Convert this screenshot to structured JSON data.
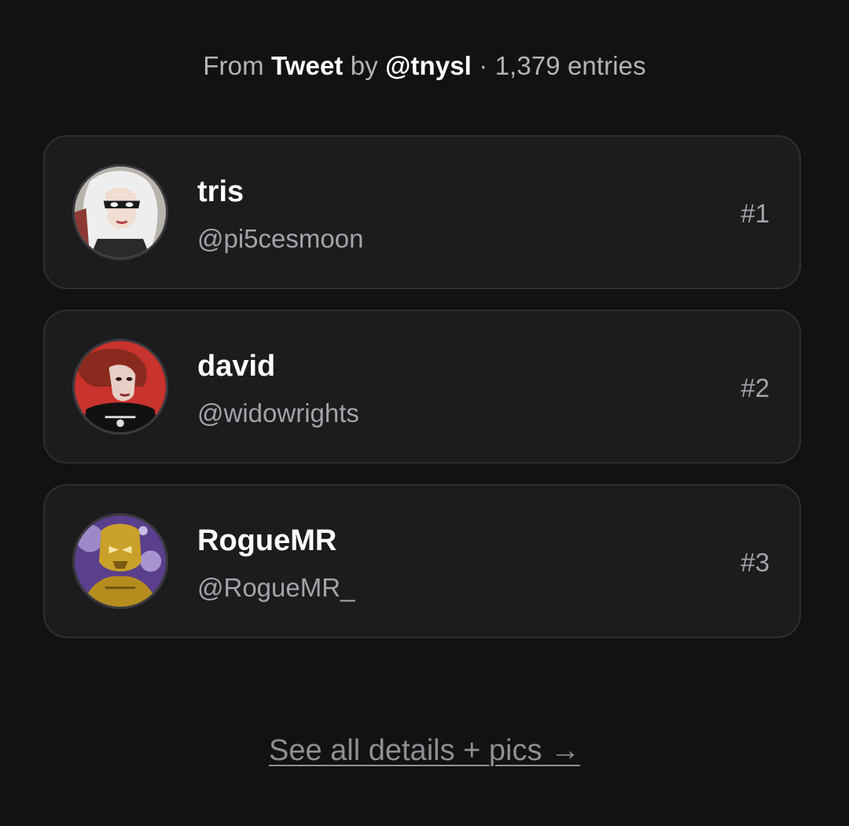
{
  "header": {
    "prefix": "From",
    "source": "Tweet",
    "by": "by",
    "author": "@tnysl",
    "separator": "·",
    "entries": "1,379 entries"
  },
  "leaderboard": [
    {
      "name": "tris",
      "handle": "@pi5cesmoon",
      "rank": "#1",
      "avatar_icon": "avatar-white-haired-masked-woman"
    },
    {
      "name": "david",
      "handle": "@widowrights",
      "rank": "#2",
      "avatar_icon": "avatar-red-haired-woman"
    },
    {
      "name": "RogueMR",
      "handle": "@RogueMR_",
      "rank": "#3",
      "avatar_icon": "avatar-golden-armored-figure"
    }
  ],
  "footer": {
    "link_label": "See all details + pics →"
  },
  "colors": {
    "background": "#121212",
    "card": "#1c1c1f",
    "card_border": "#2e2e33",
    "muted_text": "#a3a3a8",
    "link": "#8e8e94"
  }
}
